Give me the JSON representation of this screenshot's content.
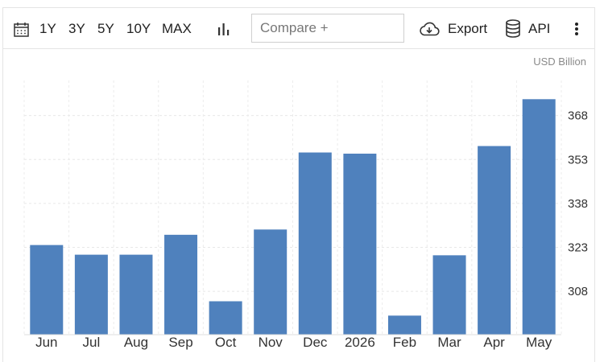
{
  "toolbar": {
    "ranges": [
      "1Y",
      "3Y",
      "5Y",
      "10Y",
      "MAX"
    ],
    "compare_placeholder": "Compare +",
    "export_label": "Export",
    "api_label": "API",
    "icons": [
      "calendar-icon",
      "bar-chart-icon",
      "cloud-download-icon",
      "database-icon",
      "more-vertical-icon"
    ]
  },
  "chart_data": {
    "type": "bar",
    "unit_label": "USD Billion",
    "categories": [
      "Jun",
      "Jul",
      "Aug",
      "Sep",
      "Oct",
      "Nov",
      "Dec",
      "2026",
      "Feb",
      "Mar",
      "Apr",
      "May"
    ],
    "values": [
      323.8,
      320.5,
      320.5,
      327.3,
      304.6,
      329.1,
      355.4,
      355.0,
      299.7,
      320.3,
      357.6,
      373.6
    ],
    "ylim": [
      293.2,
      380
    ],
    "yticks": [
      308,
      323,
      338,
      353,
      368
    ],
    "bar_color": "#4f81bd",
    "grid": true
  }
}
